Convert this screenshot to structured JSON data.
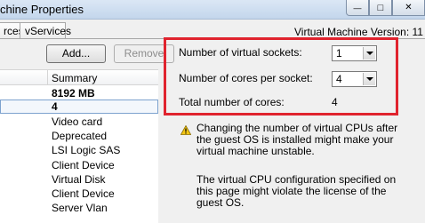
{
  "window": {
    "title": "chine Properties",
    "minimize_glyph": "—",
    "maximize_glyph": "□",
    "close_glyph": "✕"
  },
  "tabs": [
    {
      "label": "rces"
    },
    {
      "label": "vServices"
    }
  ],
  "vm_version": "Virtual Machine Version: 11",
  "toolbar": {
    "add_label": "Add...",
    "remove_label": "Remove"
  },
  "hardware_list": {
    "header": "Summary",
    "rows": [
      {
        "summary": "8192 MB"
      },
      {
        "summary": "4"
      },
      {
        "summary": "Video card"
      },
      {
        "summary": "Deprecated"
      },
      {
        "summary": "LSI Logic SAS"
      },
      {
        "summary": "Client Device"
      },
      {
        "summary": "Virtual Disk"
      },
      {
        "summary": "Client Device"
      },
      {
        "summary": "Server Vlan"
      }
    ]
  },
  "cpu": {
    "sockets_label": "Number of virtual sockets:",
    "sockets_value": "1",
    "cores_label": "Number of cores per socket:",
    "cores_value": "4",
    "total_label": "Total number of cores:",
    "total_value": "4"
  },
  "warning": {
    "icon": "warning-triangle",
    "message1": "Changing the number of virtual CPUs after the guest OS is installed might make your virtual machine unstable.",
    "message2": "The virtual CPU configuration specified on this page might violate the license of the guest OS."
  },
  "colors": {
    "highlight_box": "#e0232e",
    "warning_icon": "#f3c614"
  }
}
